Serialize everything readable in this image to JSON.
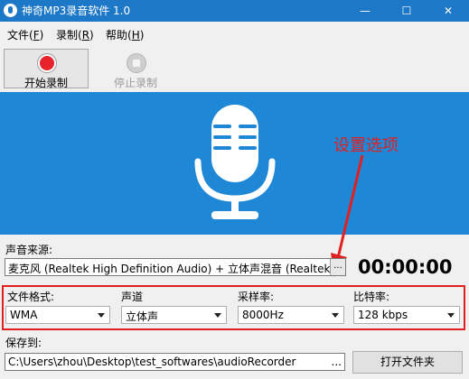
{
  "window": {
    "title": "神奇MP3录音软件 1.0",
    "minimize_glyph": "—",
    "maximize_glyph": "☐",
    "close_glyph": "✕"
  },
  "menu": [
    {
      "label": "文件(F)",
      "underline": "F"
    },
    {
      "label": "录制(R)",
      "underline": "R"
    },
    {
      "label": "帮助(H)",
      "underline": "H"
    }
  ],
  "toolbar": {
    "start_label": "开始录制",
    "stop_label": "停止录制"
  },
  "annotation": {
    "text": "设置选项",
    "color": "#e02020"
  },
  "source": {
    "label": "声音来源:",
    "value": "麦克风 (Realtek High Definition Audio) + 立体声混音 (Realtek High",
    "more": "..."
  },
  "timer": "00:00:00",
  "settings": {
    "format": {
      "label": "文件格式:",
      "value": "WMA"
    },
    "channel": {
      "label": "声道",
      "value": "立体声"
    },
    "samplerate": {
      "label": "采样率:",
      "value": "8000Hz"
    },
    "bitrate": {
      "label": "比特率:",
      "value": "128 kbps"
    }
  },
  "save": {
    "label": "保存到:",
    "path": "C:\\Users\\zhou\\Desktop\\test_softwares\\audioRecorder",
    "more": "...",
    "open_folder": "打开文件夹"
  },
  "colors": {
    "titlebar": "#1e78c8",
    "panel": "#1e88d6",
    "record_red": "#e8232b",
    "highlight_red": "#e02020"
  },
  "icons": {
    "app": "app-mic-icon",
    "record": "record-icon",
    "stop": "stop-icon",
    "microphone": "microphone-icon"
  }
}
